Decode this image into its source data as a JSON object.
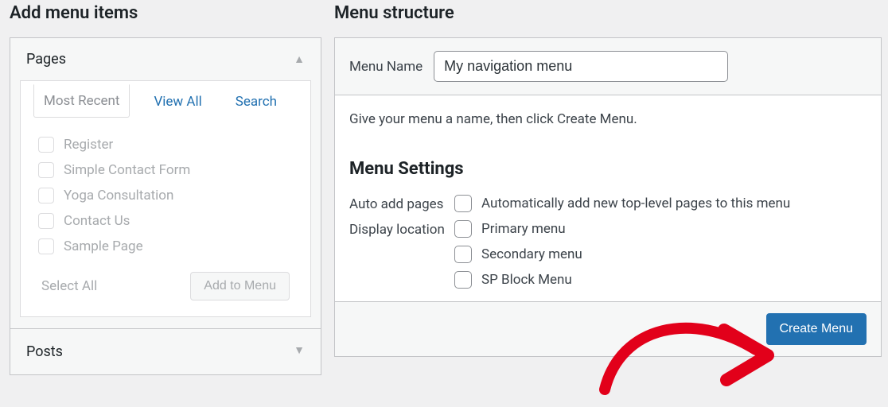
{
  "left": {
    "title": "Add menu items",
    "pages_accordion": {
      "label": "Pages",
      "tabs": {
        "recent": "Most Recent",
        "all": "View All",
        "search": "Search"
      },
      "items": [
        "Register",
        "Simple Contact Form",
        "Yoga Consultation",
        "Contact Us",
        "Sample Page"
      ],
      "select_all": "Select All",
      "add_button": "Add to Menu"
    },
    "posts_accordion": {
      "label": "Posts"
    }
  },
  "right": {
    "title": "Menu structure",
    "menu_name_label": "Menu Name",
    "menu_name_value": "My navigation menu",
    "hint": "Give your menu a name, then click Create Menu.",
    "settings_title": "Menu Settings",
    "auto_add_label": "Auto add pages",
    "auto_add_option": "Automatically add new top-level pages to this menu",
    "display_label": "Display location",
    "locations": [
      "Primary menu",
      "Secondary menu",
      "SP Block Menu"
    ],
    "create_button": "Create Menu"
  }
}
